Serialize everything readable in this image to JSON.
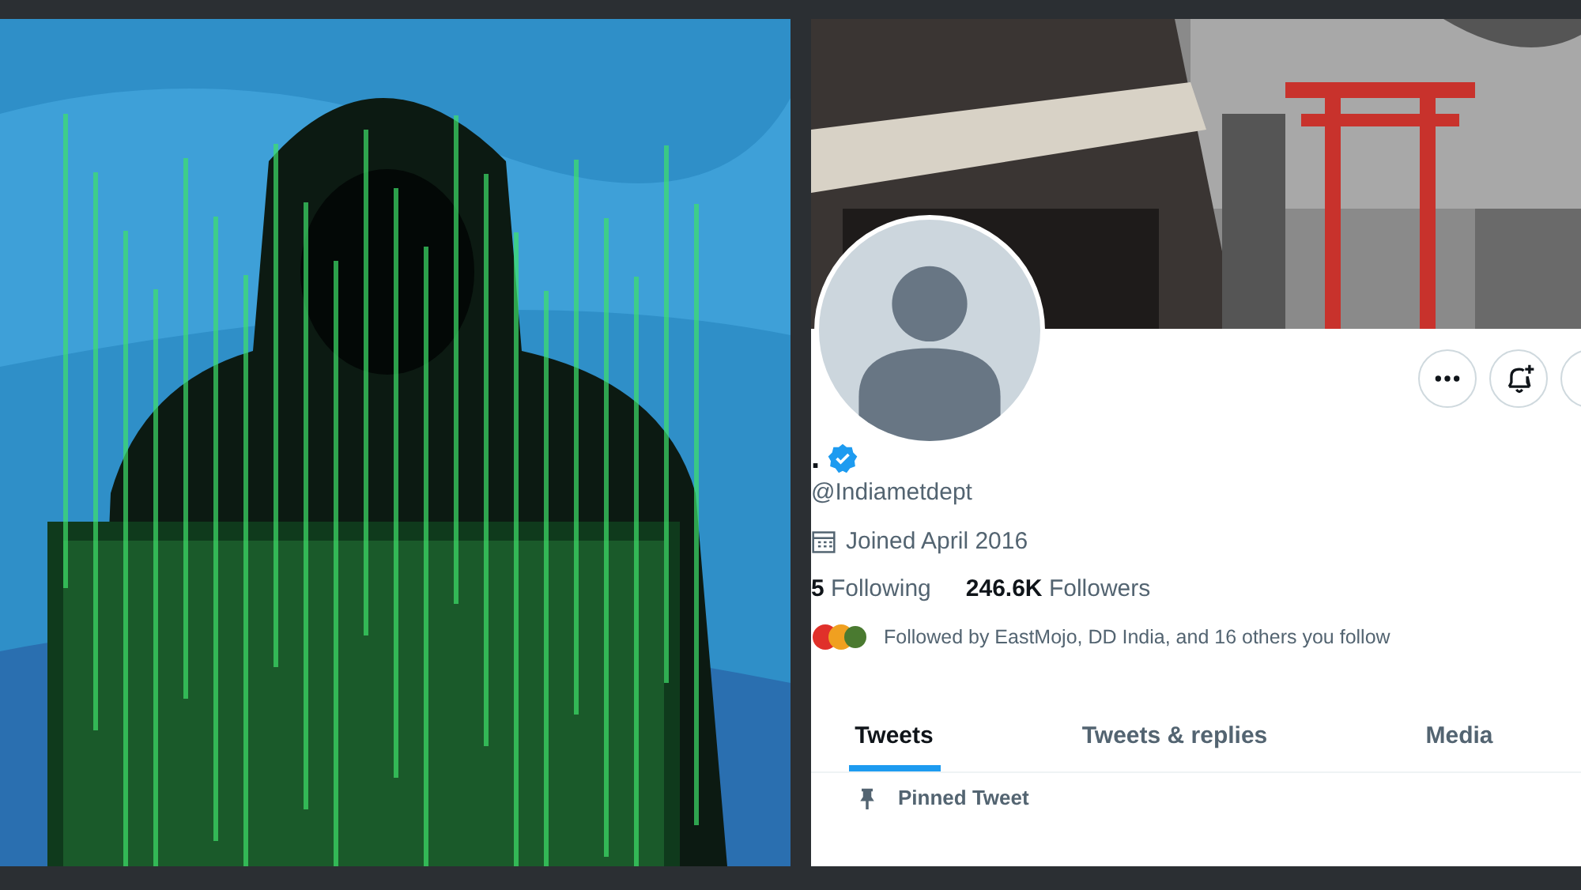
{
  "profile": {
    "name": ".",
    "verified": true,
    "handle": "@Indiametdept",
    "joined": "Joined April 2016",
    "following_count": "5",
    "following_label": "Following",
    "followers_count": "246.6K",
    "followers_label": "Followers",
    "followed_by": "Followed by EastMojo, DD India, and 16 others you follow"
  },
  "tabs": [
    {
      "label": "Tweets",
      "selected": true
    },
    {
      "label": "Tweets & replies",
      "selected": false
    },
    {
      "label": "Media",
      "selected": false
    }
  ],
  "pinned": {
    "label": "Pinned Tweet"
  }
}
